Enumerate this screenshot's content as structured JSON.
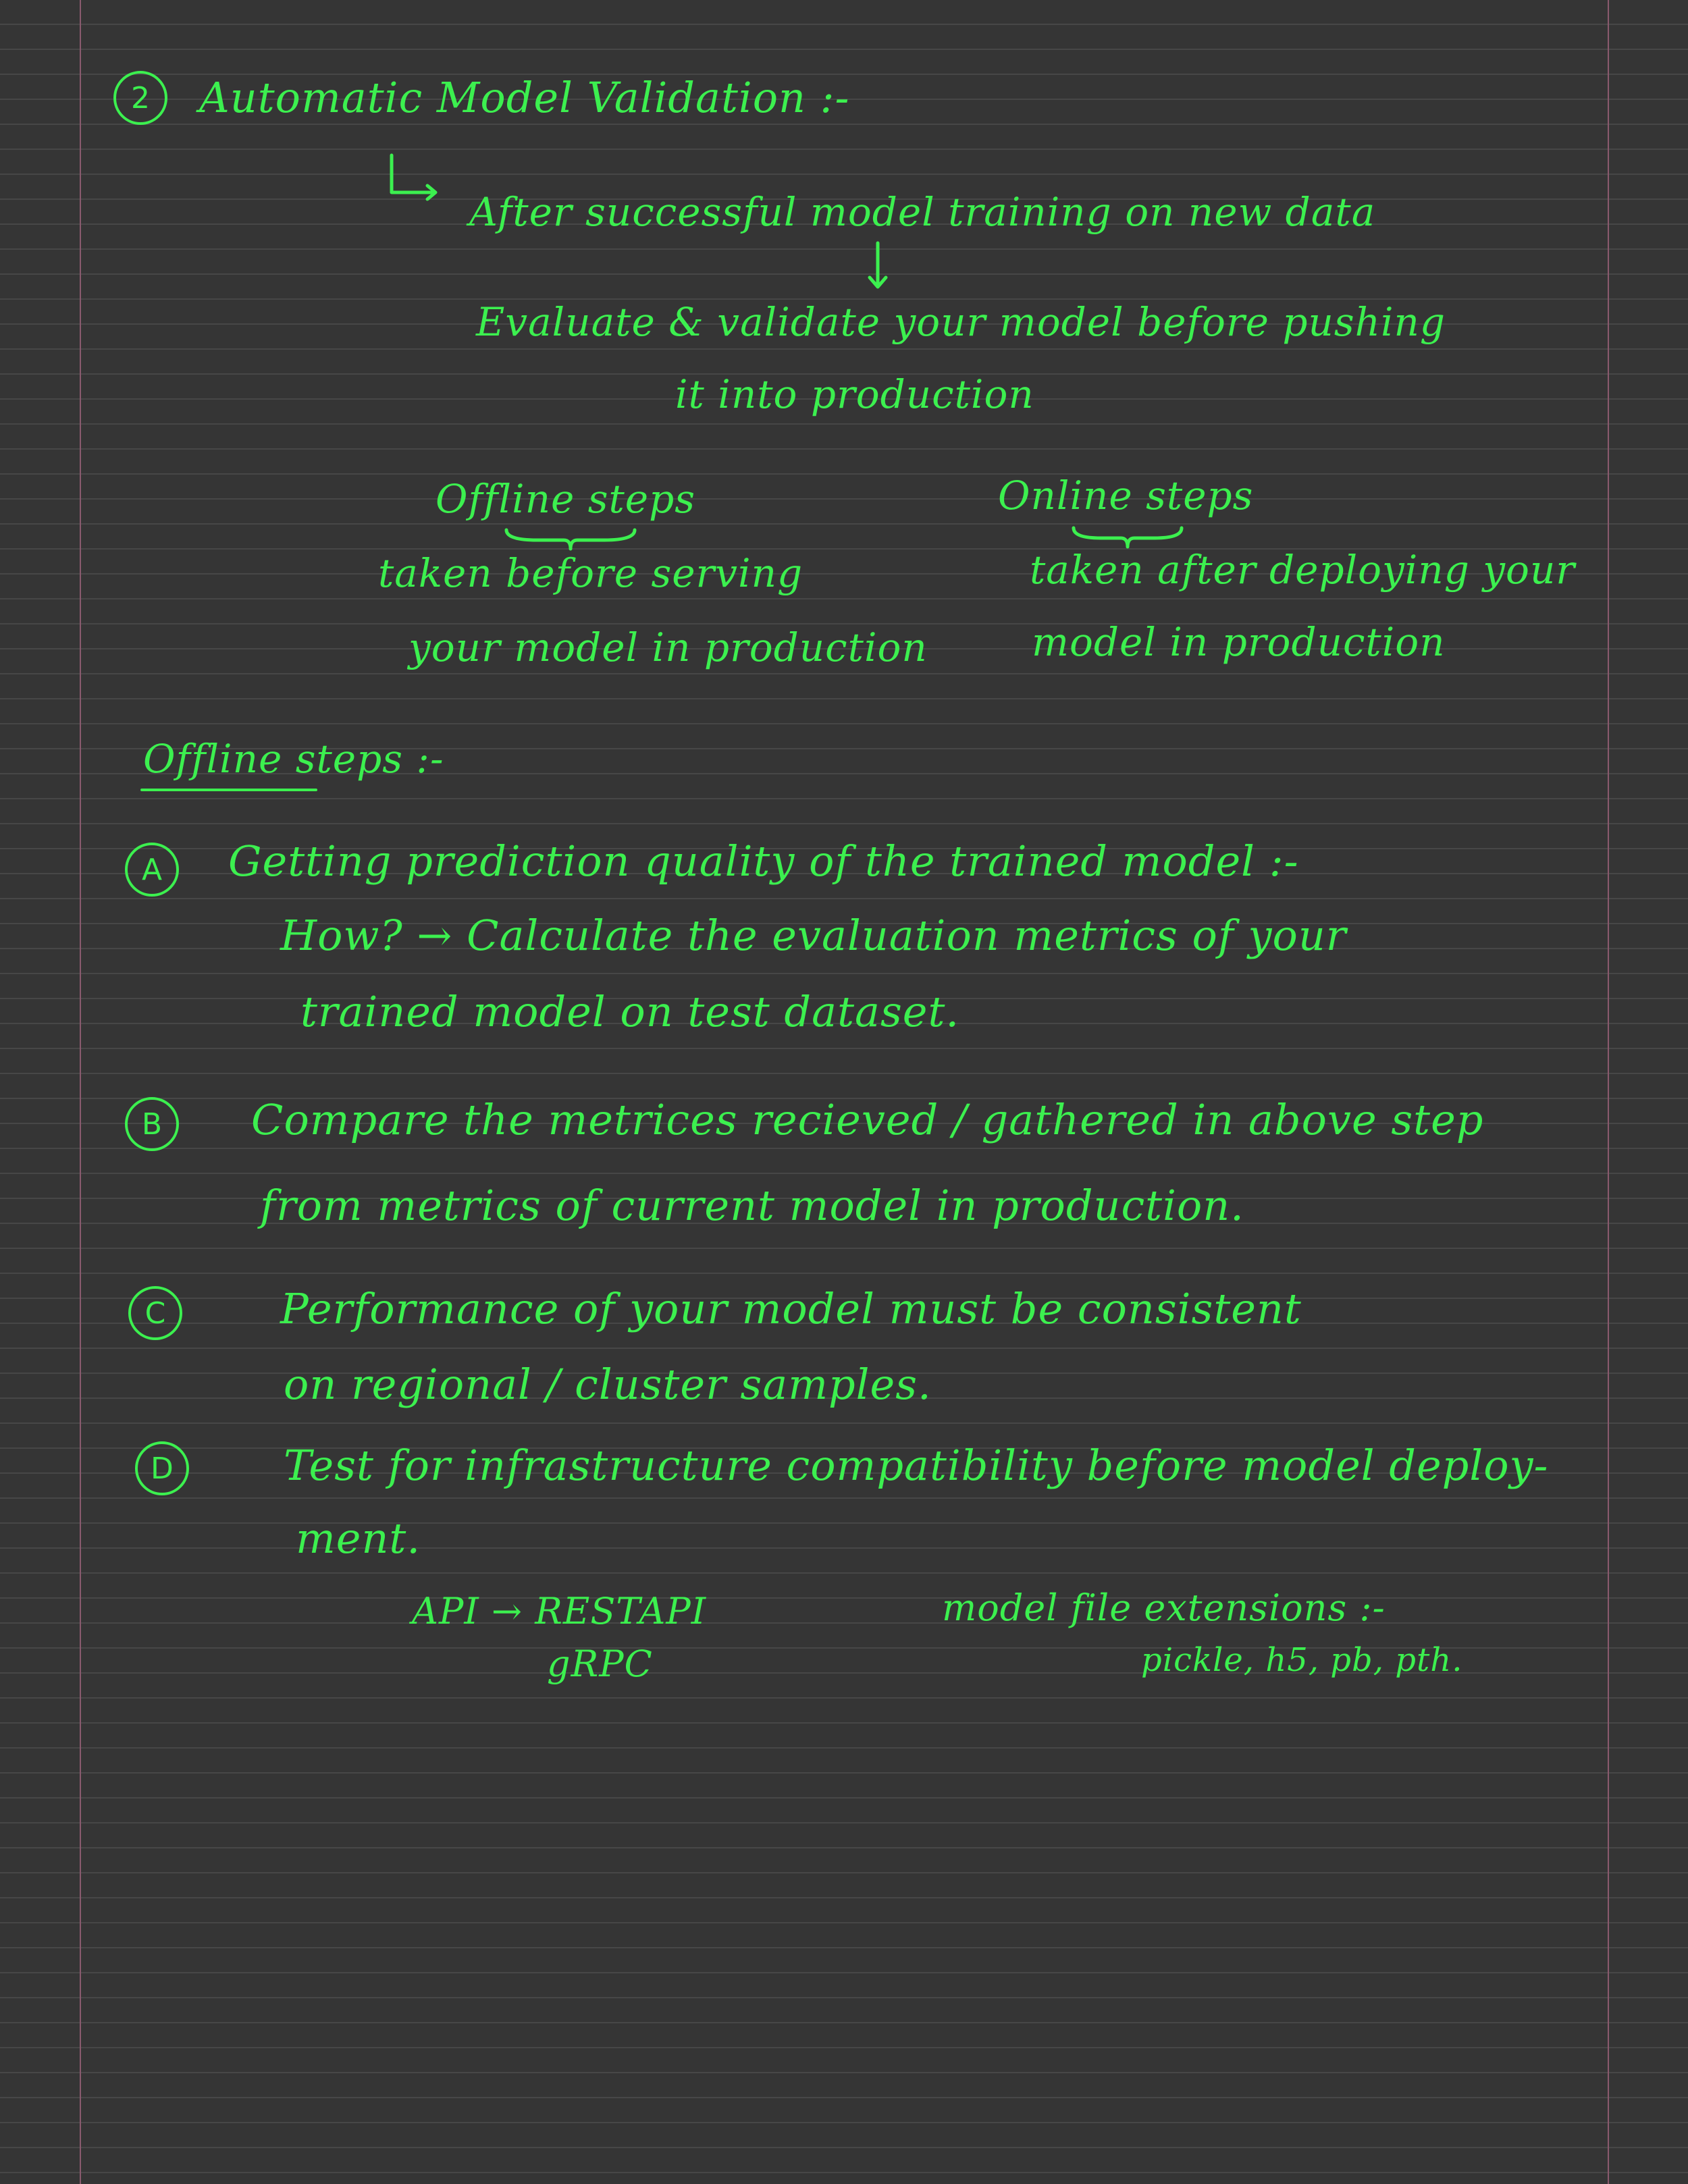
{
  "heading": {
    "number": "2",
    "title": "Automatic Model Validation :-"
  },
  "intro": {
    "line1": "After successful model training on new data",
    "line2": "Evaluate & validate your model before pushing",
    "line3": "it into production"
  },
  "steps_overview": {
    "offline": {
      "title": "Offline steps",
      "line1": "taken before serving",
      "line2": "your model in production"
    },
    "online": {
      "title": "Online steps",
      "line1": "taken after deploying your",
      "line2": "model in production"
    }
  },
  "offline_section": {
    "title": "Offline steps :-"
  },
  "items": [
    {
      "marker": "A",
      "line1": "Getting prediction quality of the trained model :-",
      "line2": "How? → Calculate the evaluation metrics of your",
      "line3": "trained model on test dataset."
    },
    {
      "marker": "B",
      "line1": "Compare the metrices recieved / gathered in above step",
      "line2": "from metrics of current model in production."
    },
    {
      "marker": "C",
      "line1": "Performance of your model must be consistent",
      "line2": "on regional / cluster samples."
    },
    {
      "marker": "D",
      "line1": "Test for infrastructure compatibility before model deploy-",
      "line2": "ment."
    }
  ],
  "api": {
    "label": "API → RESTAPI",
    "sub": "gRPC"
  },
  "extensions": {
    "label": "model file extensions :-",
    "list": "pickle, h5, pb, pth."
  },
  "colors": {
    "ink": "#3cf04f",
    "background": "#353535",
    "rule_line": "#474747",
    "margin_line": "#8a5a6e"
  }
}
